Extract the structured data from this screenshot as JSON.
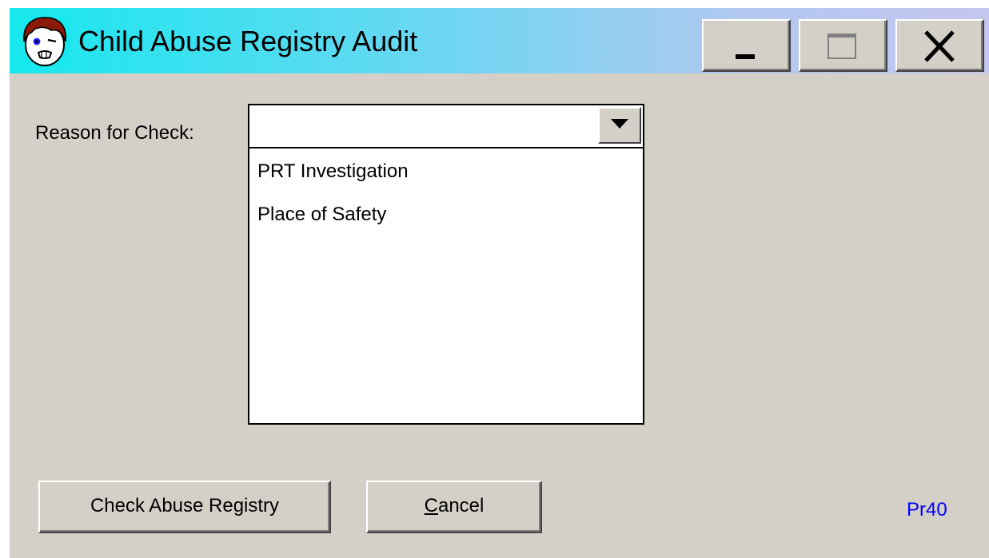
{
  "window": {
    "title": "Child Abuse Registry Audit",
    "icon": "child-face-icon",
    "controls": {
      "minimize": "minimize-icon",
      "maximize": "maximize-icon",
      "close": "close-icon"
    }
  },
  "form": {
    "reason_label": "Reason for Check:",
    "reason_value": "",
    "reason_options": [
      "PRT Investigation",
      "Place of Safety"
    ],
    "check_button_label": "Check Abuse Registry",
    "cancel_button": {
      "access_key": "C",
      "rest": "ancel"
    },
    "form_code": "Pr40"
  },
  "colors": {
    "title_gradient_start": "#17e8ee",
    "title_gradient_end": "#c4c6ef",
    "window_face": "#d4d0c8",
    "form_code_color": "#0000ff"
  }
}
